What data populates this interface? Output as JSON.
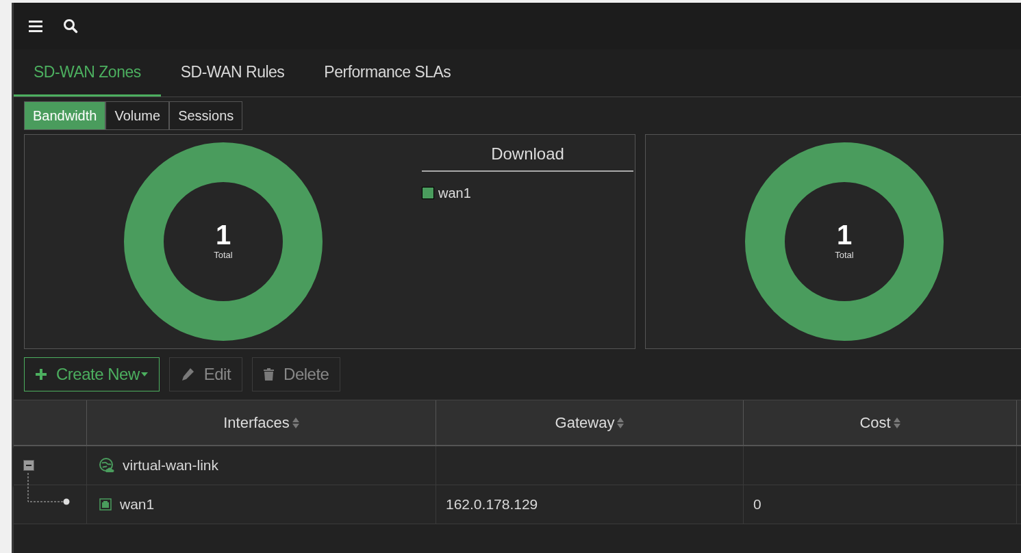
{
  "tabs": [
    {
      "label": "SD-WAN Zones",
      "selected": true
    },
    {
      "label": "SD-WAN Rules",
      "selected": false
    },
    {
      "label": "Performance SLAs",
      "selected": false
    }
  ],
  "view_tabs": [
    {
      "label": "Bandwidth",
      "selected": true
    },
    {
      "label": "Volume",
      "selected": false
    },
    {
      "label": "Sessions",
      "selected": false
    }
  ],
  "charts": [
    {
      "center_value": "1",
      "center_label": "Total",
      "legend_title": "Download",
      "legend": [
        {
          "label": "wan1",
          "color": "#4a9c5d"
        }
      ]
    },
    {
      "center_value": "1",
      "center_label": "Total"
    }
  ],
  "actions": [
    {
      "label": "Create New",
      "kind": "create",
      "disabled": false
    },
    {
      "label": "Edit",
      "kind": "edit",
      "disabled": true
    },
    {
      "label": "Delete",
      "kind": "delete",
      "disabled": true
    }
  ],
  "table": {
    "columns": [
      "Interfaces",
      "Gateway",
      "Cost"
    ],
    "rows": [
      {
        "kind": "zone",
        "interface": "virtual-wan-link",
        "expanded": true,
        "children": [
          {
            "kind": "port",
            "interface": "wan1",
            "gateway": "162.0.178.129",
            "cost": "0"
          }
        ]
      }
    ]
  }
}
